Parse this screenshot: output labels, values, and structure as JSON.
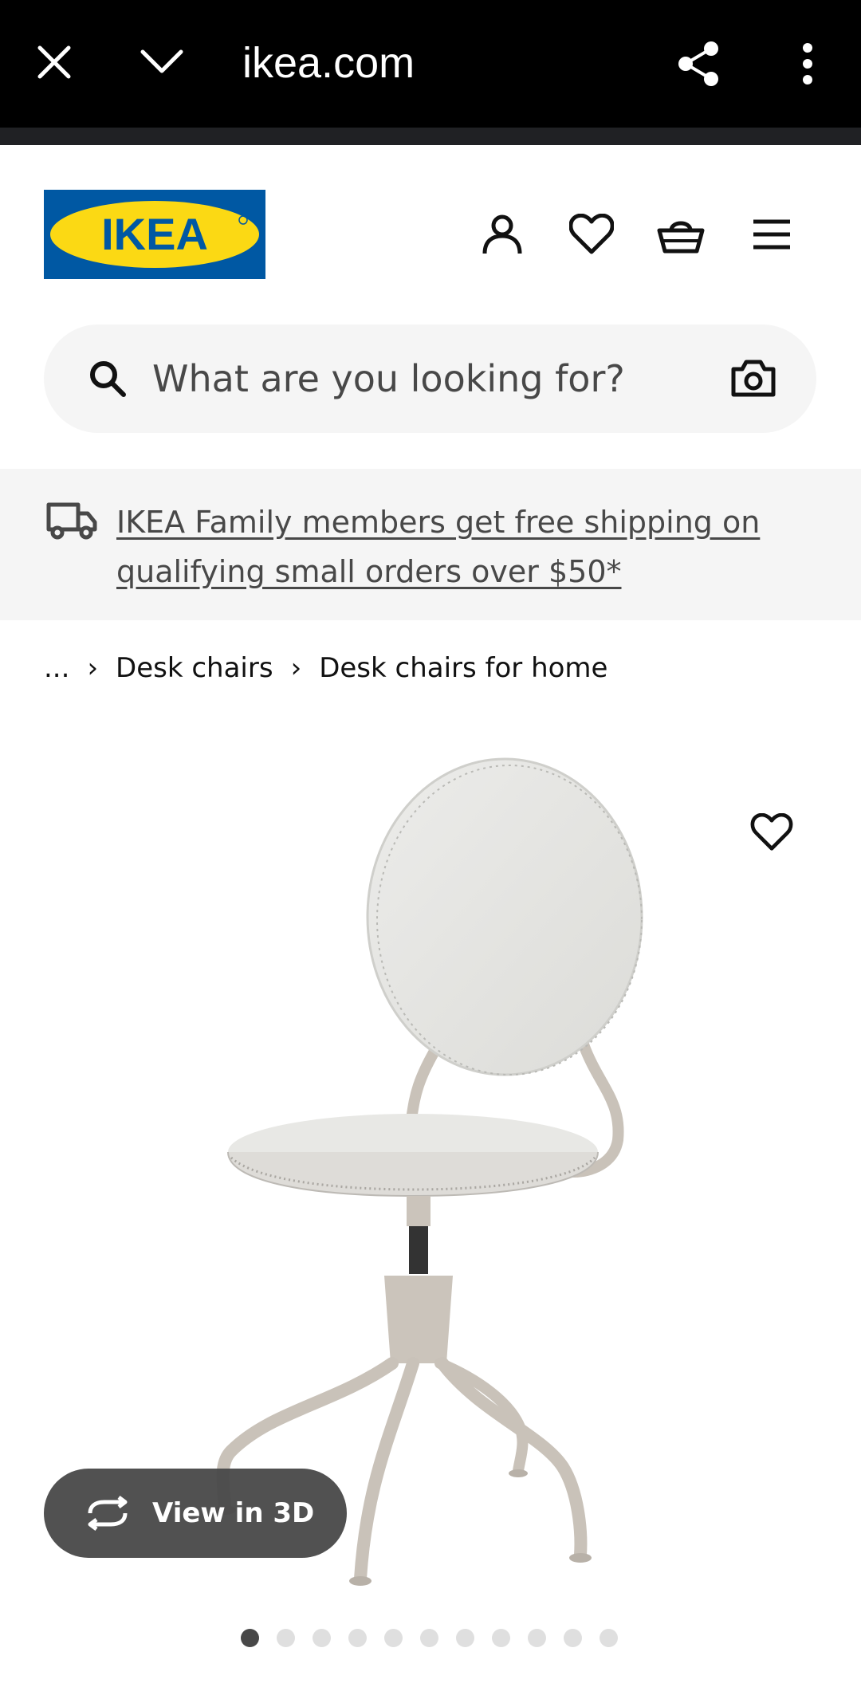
{
  "browser": {
    "url": "ikea.com",
    "icons": [
      "close-icon",
      "chevron-down-icon",
      "share-icon",
      "more-vert-icon"
    ]
  },
  "header": {
    "logo_text": "IKEA",
    "icons": [
      "account-icon",
      "heart-icon",
      "basket-icon",
      "menu-icon"
    ]
  },
  "search": {
    "placeholder": "What are you looking for?"
  },
  "banner": {
    "text": "IKEA Family members get free shipping on qualifying small orders over $50*"
  },
  "breadcrumb": {
    "items": [
      "...",
      "Desk chairs",
      "Desk chairs for home"
    ]
  },
  "product": {
    "view3d_label": "View in 3D",
    "image_count": 11,
    "active_image": 1
  },
  "colors": {
    "ikea_blue": "#0058a3",
    "ikea_yellow": "#fbd914",
    "banner_bg": "#f5f5f5",
    "text_dark": "#111111"
  }
}
